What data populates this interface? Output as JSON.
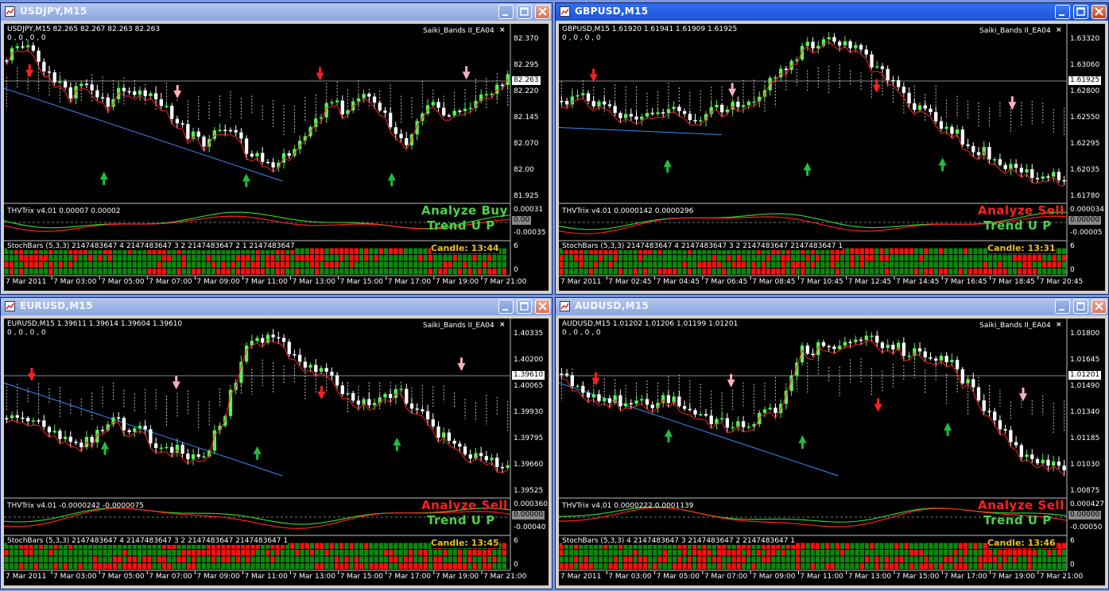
{
  "colors": {
    "bull": "#5af05a",
    "bear": "#ffffff",
    "ma": "#ff2020",
    "trend": "#3a8cff",
    "arrowUp": "#1fbf3f",
    "arrowDown": "#ff2020",
    "arrowPink": "#ffb0c0",
    "cloud": "#ffffff",
    "grid": "#303030",
    "buyText": "#4cd04c",
    "sellText": "#ff2020",
    "stochRed": "#ff1010",
    "stochGreen": "#0a8a0a"
  },
  "icons": [
    "chart-window-icon",
    "minimize-icon",
    "maximize-icon",
    "close-icon",
    "arrow-up-icon",
    "arrow-down-icon"
  ],
  "windows": [
    {
      "id": "usdjpy",
      "title": "USDJPY,M15",
      "active": false,
      "ohlc": "USDJPY,M15  82.265 82.267 82.263 82.263",
      "sub": "0 , 0 , 0 , 0",
      "ea": "Saiki_Bands II_EA04",
      "prices": [
        "82.370",
        "82.295",
        "82.220",
        "82.145",
        "82.070",
        "82.00",
        "81.925"
      ],
      "curPrice": "82.263",
      "ind": "THVTrix v4.01 0.00007 0.00002",
      "indScale": [
        "0.00031",
        "0.00",
        "-0.00035"
      ],
      "indTag": "0.00",
      "analyze": "Analyze Buy",
      "analyzeColor": "#4cd04c",
      "trend": "Trend U P",
      "stoch": "StochBars (5,3,3) 2147483647 4 2147483647 3 2 2147483647 2 1 2147483647",
      "candle": "Candle:  13:44",
      "stochScale": [
        "6",
        "0"
      ],
      "times": [
        "7 Mar 2011",
        "7 Mar 03:00",
        "7 Mar 05:00",
        "7 Mar 07:00",
        "7 Mar 09:00",
        "7 Mar 11:00",
        "7 Mar 13:00",
        "7 Mar 15:00",
        "7 Mar 17:00",
        "7 Mar 19:00",
        "7 Mar 21:00"
      ]
    },
    {
      "id": "gbpusd",
      "title": "GBPUSD,M15",
      "active": true,
      "ohlc": "GBPUSD,M15  1.61920 1.61941 1.61909 1.61925",
      "sub": "0 , 0 , 0 , 0",
      "ea": "Saiki_Bands II_EA04",
      "prices": [
        "1.63320",
        "1.63060",
        "1.62800",
        "1.62550",
        "1.62295",
        "1.62035",
        "1.61780"
      ],
      "curPrice": "1.61925",
      "ind": "THVTrix v4.01 0.0000142 0.0000296",
      "indScale": [
        "0.000034",
        "0.00000",
        "-0.00005"
      ],
      "indTag": "0.00000",
      "analyze": "Analyze Sell",
      "analyzeColor": "#ff2020",
      "trend": "Trend U P",
      "stoch": "StochBars (5,3,3) 2147483647 4 2147483647 3 2 2147483647 2147483647 1",
      "candle": "Candle:  13:31",
      "stochScale": [
        "6",
        "0"
      ],
      "times": [
        "7 Mar 2011",
        "7 Mar 02:45",
        "7 Mar 04:45",
        "7 Mar 06:45",
        "7 Mar 08:45",
        "7 Mar 10:45",
        "7 Mar 12:45",
        "7 Mar 14:45",
        "7 Mar 16:45",
        "7 Mar 18:45",
        "7 Mar 20:45"
      ]
    },
    {
      "id": "eurusd",
      "title": "EURUSD,M15",
      "active": false,
      "ohlc": "EURUSD,M15  1.39611 1.39614 1.39604 1.39610",
      "sub": "0 , 0 , 0 , 0",
      "ea": "Saiki_Bands II_EA04",
      "prices": [
        "1.40335",
        "1.40200",
        "1.40065",
        "1.39930",
        "1.39795",
        "1.39660",
        "1.39525"
      ],
      "curPrice": "1.39610",
      "ind": "THVTrix v4.01 -0.0000242 -0.0000075",
      "indScale": [
        "0.000360",
        "0.00000",
        "-0.00040"
      ],
      "indTag": "0.00000",
      "analyze": "Analyze Sell",
      "analyzeColor": "#ff2020",
      "trend": "Trend U P",
      "stoch": "StochBars (5,3,3) 2147483647 4 2147483647 3 2 2147483647 2147483647 1",
      "candle": "Candle:  13:45",
      "stochScale": [
        "6",
        "0"
      ],
      "times": [
        "7 Mar 2011",
        "7 Mar 03:00",
        "7 Mar 05:00",
        "7 Mar 07:00",
        "7 Mar 09:00",
        "7 Mar 11:00",
        "7 Mar 13:00",
        "7 Mar 15:00",
        "7 Mar 17:00",
        "7 Mar 19:00",
        "7 Mar 21:00"
      ]
    },
    {
      "id": "audusd",
      "title": "AUDUSD,M15",
      "active": false,
      "ohlc": "AUDUSD,M15  1.01202 1.01206 1.01199 1.01201",
      "sub": "0 , 0 , 0 , 0",
      "ea": "Saiki_Bands II_EA04",
      "prices": [
        "1.01800",
        "1.01645",
        "1.01490",
        "1.01340",
        "1.01185",
        "1.01030",
        "1.00875"
      ],
      "curPrice": "1.01201",
      "ind": "THVTrix v4.01 0.0000222 0.0001139",
      "indScale": [
        "0.000427",
        "0.00000",
        "-0.00050"
      ],
      "indTag": "0.00000",
      "analyze": "Analyze Sell",
      "analyzeColor": "#ff2020",
      "trend": "Trend U P",
      "stoch": "StochBars (5,3,3) 4 2147483647 3 2147483647 2 2147483647 1",
      "candle": "Candle:  13:46",
      "stochScale": [
        "6",
        "0"
      ],
      "times": [
        "7 Mar 2011",
        "7 Mar 03:00",
        "7 Mar 05:00",
        "7 Mar 07:00",
        "7 Mar 09:00",
        "7 Mar 11:00",
        "7 Mar 13:00",
        "7 Mar 15:00",
        "7 Mar 17:00",
        "7 Mar 19:00",
        "7 Mar 21:00"
      ]
    }
  ]
}
